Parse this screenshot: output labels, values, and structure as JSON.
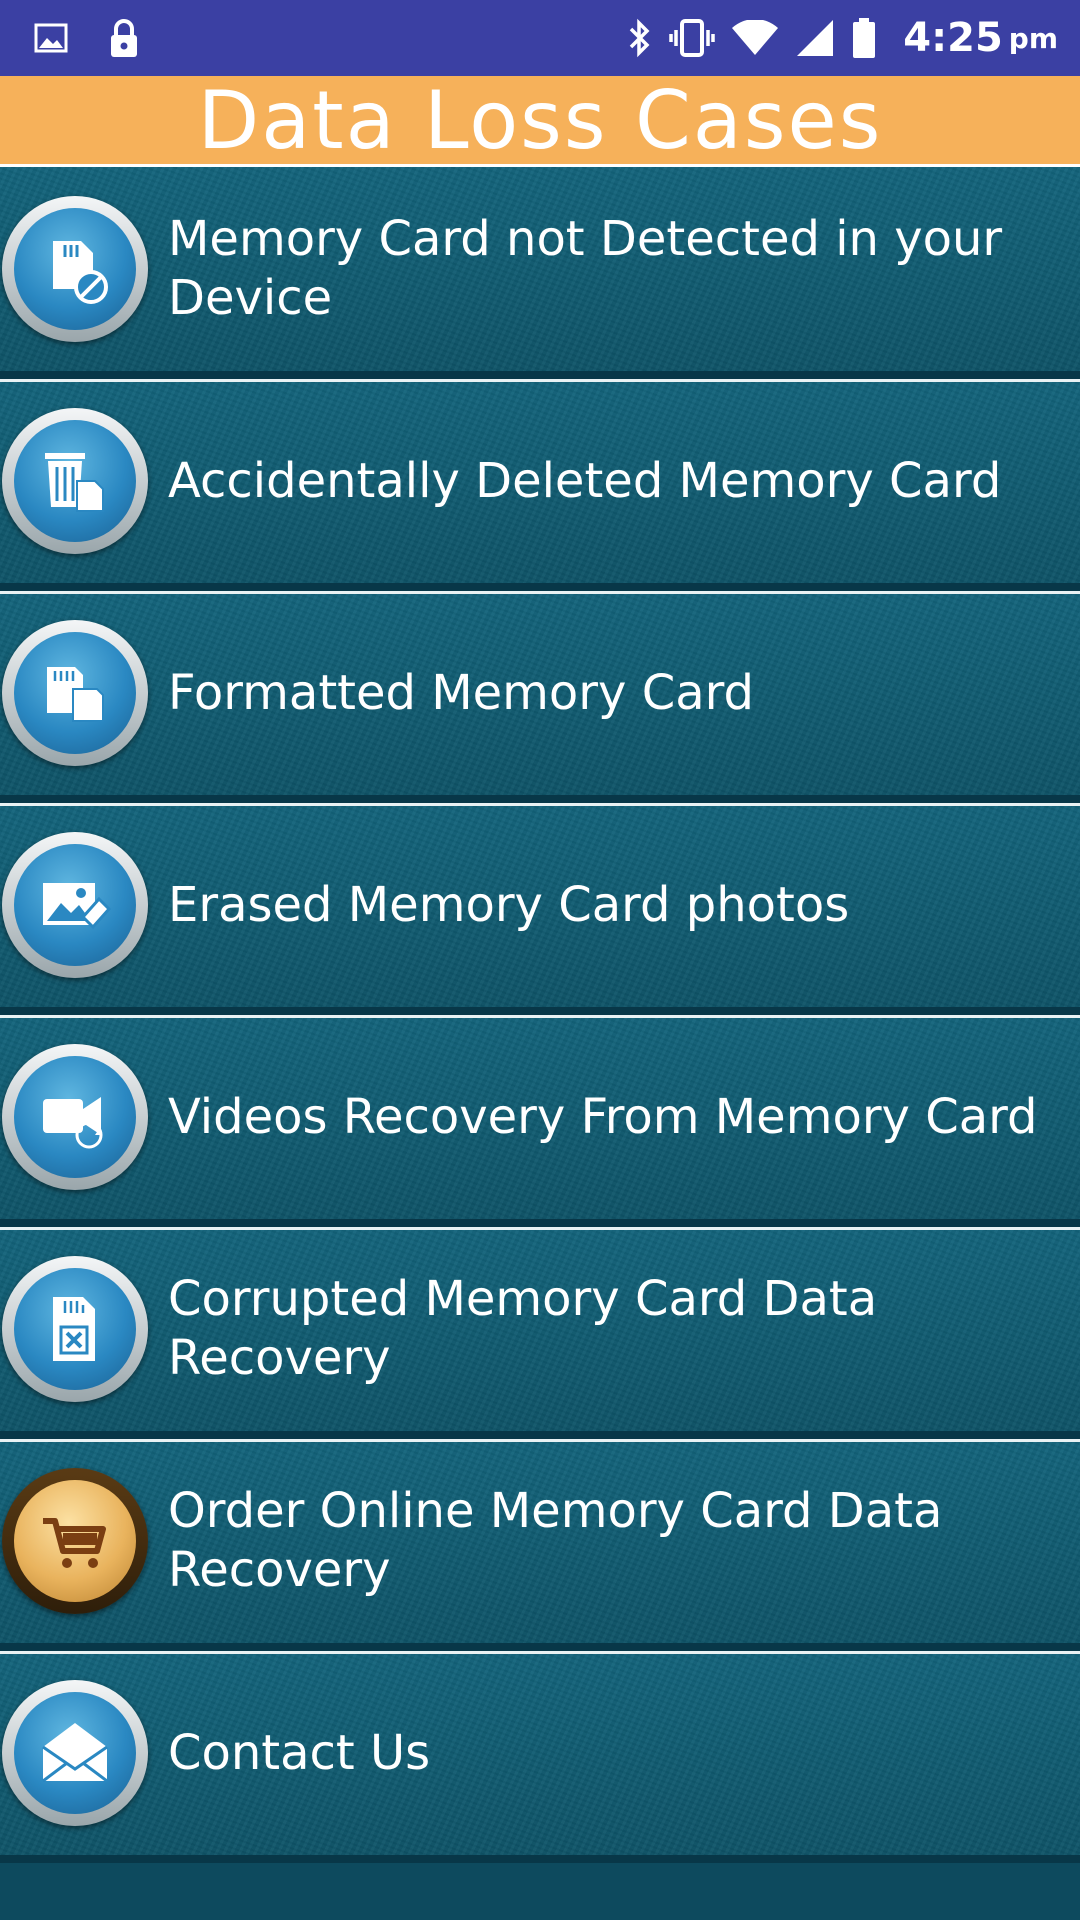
{
  "status_bar": {
    "time": "4:25",
    "ampm": "pm",
    "icons": [
      "image-icon",
      "lock-icon",
      "bluetooth-icon",
      "vibrate-icon",
      "wifi-icon",
      "signal-icon",
      "battery-icon"
    ]
  },
  "header": {
    "title": "Data Loss Cases"
  },
  "items": [
    {
      "label": "Memory Card not Detected in your Device",
      "icon": "sd-card-disabled-icon"
    },
    {
      "label": "Accidentally Deleted Memory Card",
      "icon": "trash-card-icon"
    },
    {
      "label": "Formatted Memory Card",
      "icon": "format-card-icon"
    },
    {
      "label": "Erased Memory Card photos",
      "icon": "erased-photo-icon"
    },
    {
      "label": "Videos Recovery From Memory Card",
      "icon": "video-recover-icon"
    },
    {
      "label": "Corrupted Memory Card Data Recovery",
      "icon": "corrupted-card-icon"
    },
    {
      "label": "Order Online Memory Card Data Recovery",
      "icon": "shopping-cart-icon"
    },
    {
      "label": "Contact Us",
      "icon": "mail-icon"
    }
  ],
  "colors": {
    "status_bar": "#3b40a3",
    "header": "#f6b15a",
    "row": "#0f5a70",
    "icon_blue": "#2a88c2",
    "icon_gold": "#e9b35d"
  }
}
